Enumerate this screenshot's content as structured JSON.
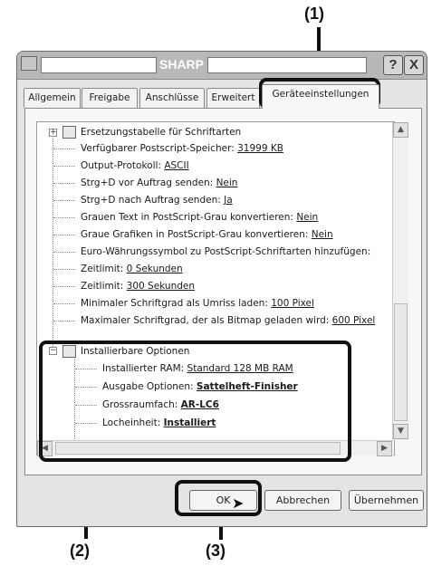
{
  "callouts": [
    "(1)",
    "(2)",
    "(3)"
  ],
  "window": {
    "title": "SHARP",
    "buttons": {
      "help": "?",
      "close": "X"
    }
  },
  "tabs": [
    "Allgemein",
    "Freigabe",
    "Anschlüsse",
    "Erweitert",
    "Geräteeinstellungen"
  ],
  "tree": {
    "rows": [
      {
        "label": "Ersetzungstabelle für Schriftarten",
        "value": ""
      },
      {
        "label": "Verfügbarer Postscript-Speicher: ",
        "value": "31999 KB"
      },
      {
        "label": "Output-Protokoll: ",
        "value": "ASCII"
      },
      {
        "label": "Strg+D vor Auftrag senden: ",
        "value": "Nein"
      },
      {
        "label": "Strg+D nach Auftrag senden: ",
        "value": "Ja"
      },
      {
        "label": "Grauen Text in PostScript-Grau konvertieren: ",
        "value": "Nein"
      },
      {
        "label": "Graue Grafiken in PostScript-Grau konvertieren: ",
        "value": "Nein"
      },
      {
        "label": "Euro-Währungssymbol zu PostScript-Schriftarten hinzufügen:",
        "value": ""
      },
      {
        "label": "Zeitlimit: ",
        "value": "0 Sekunden"
      },
      {
        "label": "Zeitlimit: ",
        "value": "300 Sekunden"
      },
      {
        "label": "Minimaler Schriftgrad als Umriss laden: ",
        "value": "100 Pixel"
      },
      {
        "label": "Maximaler Schriftgrad, der als Bitmap geladen wird: ",
        "value": "600 Pixel"
      },
      {
        "label": "Installierbare Optionen",
        "value": ""
      },
      {
        "label": "Installierter RAM: ",
        "value": "Standard 128 MB RAM"
      },
      {
        "label": "Ausgabe Optionen: ",
        "value": "Sattelheft-Finisher"
      },
      {
        "label": "Grossraumfach: ",
        "value": "AR-LC6"
      },
      {
        "label": "Locheinheit: ",
        "value": "Installiert"
      }
    ]
  },
  "footer": {
    "ok": "OK",
    "cancel": "Abbrechen",
    "apply": "Übernehmen"
  }
}
